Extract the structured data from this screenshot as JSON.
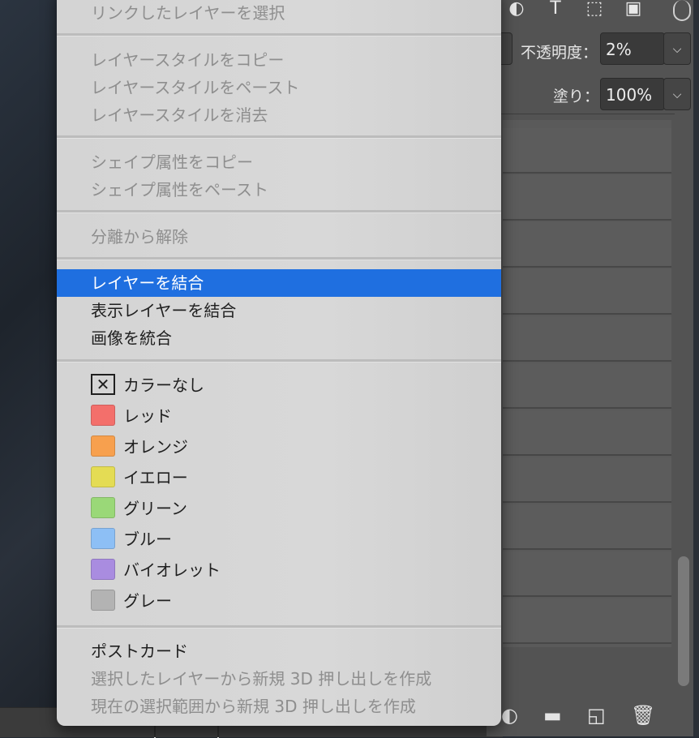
{
  "menu": {
    "items": [
      {
        "label": "リンクしたレイヤーを選択",
        "enabled": false
      },
      {
        "label": "レイヤースタイルをコピー",
        "enabled": false
      },
      {
        "label": "レイヤースタイルをペースト",
        "enabled": false
      },
      {
        "label": "レイヤースタイルを消去",
        "enabled": false
      },
      {
        "label": "シェイプ属性をコピー",
        "enabled": false
      },
      {
        "label": "シェイプ属性をペースト",
        "enabled": false
      },
      {
        "label": "分離から解除",
        "enabled": false
      },
      {
        "label": "レイヤーを結合",
        "enabled": true,
        "highlighted": true
      },
      {
        "label": "表示レイヤーを結合",
        "enabled": true
      },
      {
        "label": "画像を統合",
        "enabled": true
      },
      {
        "label": "ポストカード",
        "enabled": true
      },
      {
        "label": "選択したレイヤーから新規 3D 押し出しを作成",
        "enabled": false
      },
      {
        "label": "現在の選択範囲から新規 3D 押し出しを作成",
        "enabled": false
      }
    ],
    "colors": [
      {
        "label": "カラーなし",
        "color": "none"
      },
      {
        "label": "レッド",
        "color": "#f36f6b"
      },
      {
        "label": "オレンジ",
        "color": "#f7a04e"
      },
      {
        "label": "イエロー",
        "color": "#e4dc54"
      },
      {
        "label": "グリーン",
        "color": "#9ad878"
      },
      {
        "label": "ブルー",
        "color": "#8dbff5"
      },
      {
        "label": "バイオレット",
        "color": "#a98ce0"
      },
      {
        "label": "グレー",
        "color": "#b3b3b3"
      }
    ],
    "highlight_color": "#1f6fe0"
  },
  "panel": {
    "opacity_label": "不透明度：",
    "opacity_value": "2%",
    "fill_label": "塗り：",
    "fill_value": "100%"
  }
}
